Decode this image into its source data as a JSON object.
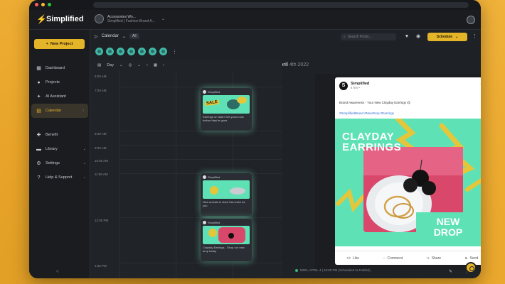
{
  "app": {
    "name": "Simplified"
  },
  "workspace": {
    "name": "Accessories Wo...",
    "sub": "Simplified | Fashion Brand A..."
  },
  "sidebar": {
    "new_project": "New Project",
    "items": [
      {
        "label": "Dashboard",
        "icon": "grid-icon"
      },
      {
        "label": "Projects",
        "icon": "folder-icon"
      },
      {
        "label": "AI Assistant",
        "icon": "sparkle-icon"
      },
      {
        "label": "Calendar",
        "icon": "calendar-icon",
        "active": true
      },
      {
        "label": "Benefit",
        "icon": "gift-icon"
      },
      {
        "label": "Library",
        "icon": "library-icon"
      },
      {
        "label": "Settings",
        "icon": "gear-icon"
      },
      {
        "label": "Help & Support",
        "icon": "help-icon"
      }
    ]
  },
  "calendar": {
    "title": "Calendar",
    "tag": "All",
    "view": "Day",
    "date_bold": "MON, April",
    "date_rest": "4th 2022",
    "search_placeholder": "Search Posts...",
    "schedule_label": "Schedule",
    "times": [
      "6:00 AM",
      "7:00 AM",
      "8:00 AM",
      "9:00 AM",
      "10:00 AM",
      "11:00 AM",
      "12:00 PM",
      "1:00 PM"
    ],
    "cards": [
      {
        "account": "Simplified",
        "tag": "SALE",
        "text": "Earrings on Sale! Get yours now before they're gone"
      },
      {
        "account": "Simplified",
        "tag": "",
        "text": "New arrivals in store this week for you"
      },
      {
        "account": "Simplified",
        "tag": "",
        "text": "Clayday Earrings - Shop our new drop today"
      }
    ]
  },
  "preview": {
    "account": "Simplified",
    "account_sub": "4 hrs •",
    "caption": "Brand Awareness - Your New Clayday Earrings @",
    "tags": "#SimplifiedBrand #NewDrop #Earrings",
    "promo_title_1": "CLAYDAY",
    "promo_title_2": "EARRINGS",
    "promo_new": "NEW",
    "promo_drop": "DROP",
    "actions": [
      "Like",
      "Comment",
      "Share",
      "Send"
    ],
    "status": "MON, APRIL 4 | 10:00 PM (Scheduled to Publish)"
  },
  "colors": {
    "accent": "#e4b429",
    "bg": "#1e2126",
    "teal": "#5ee2b5"
  }
}
